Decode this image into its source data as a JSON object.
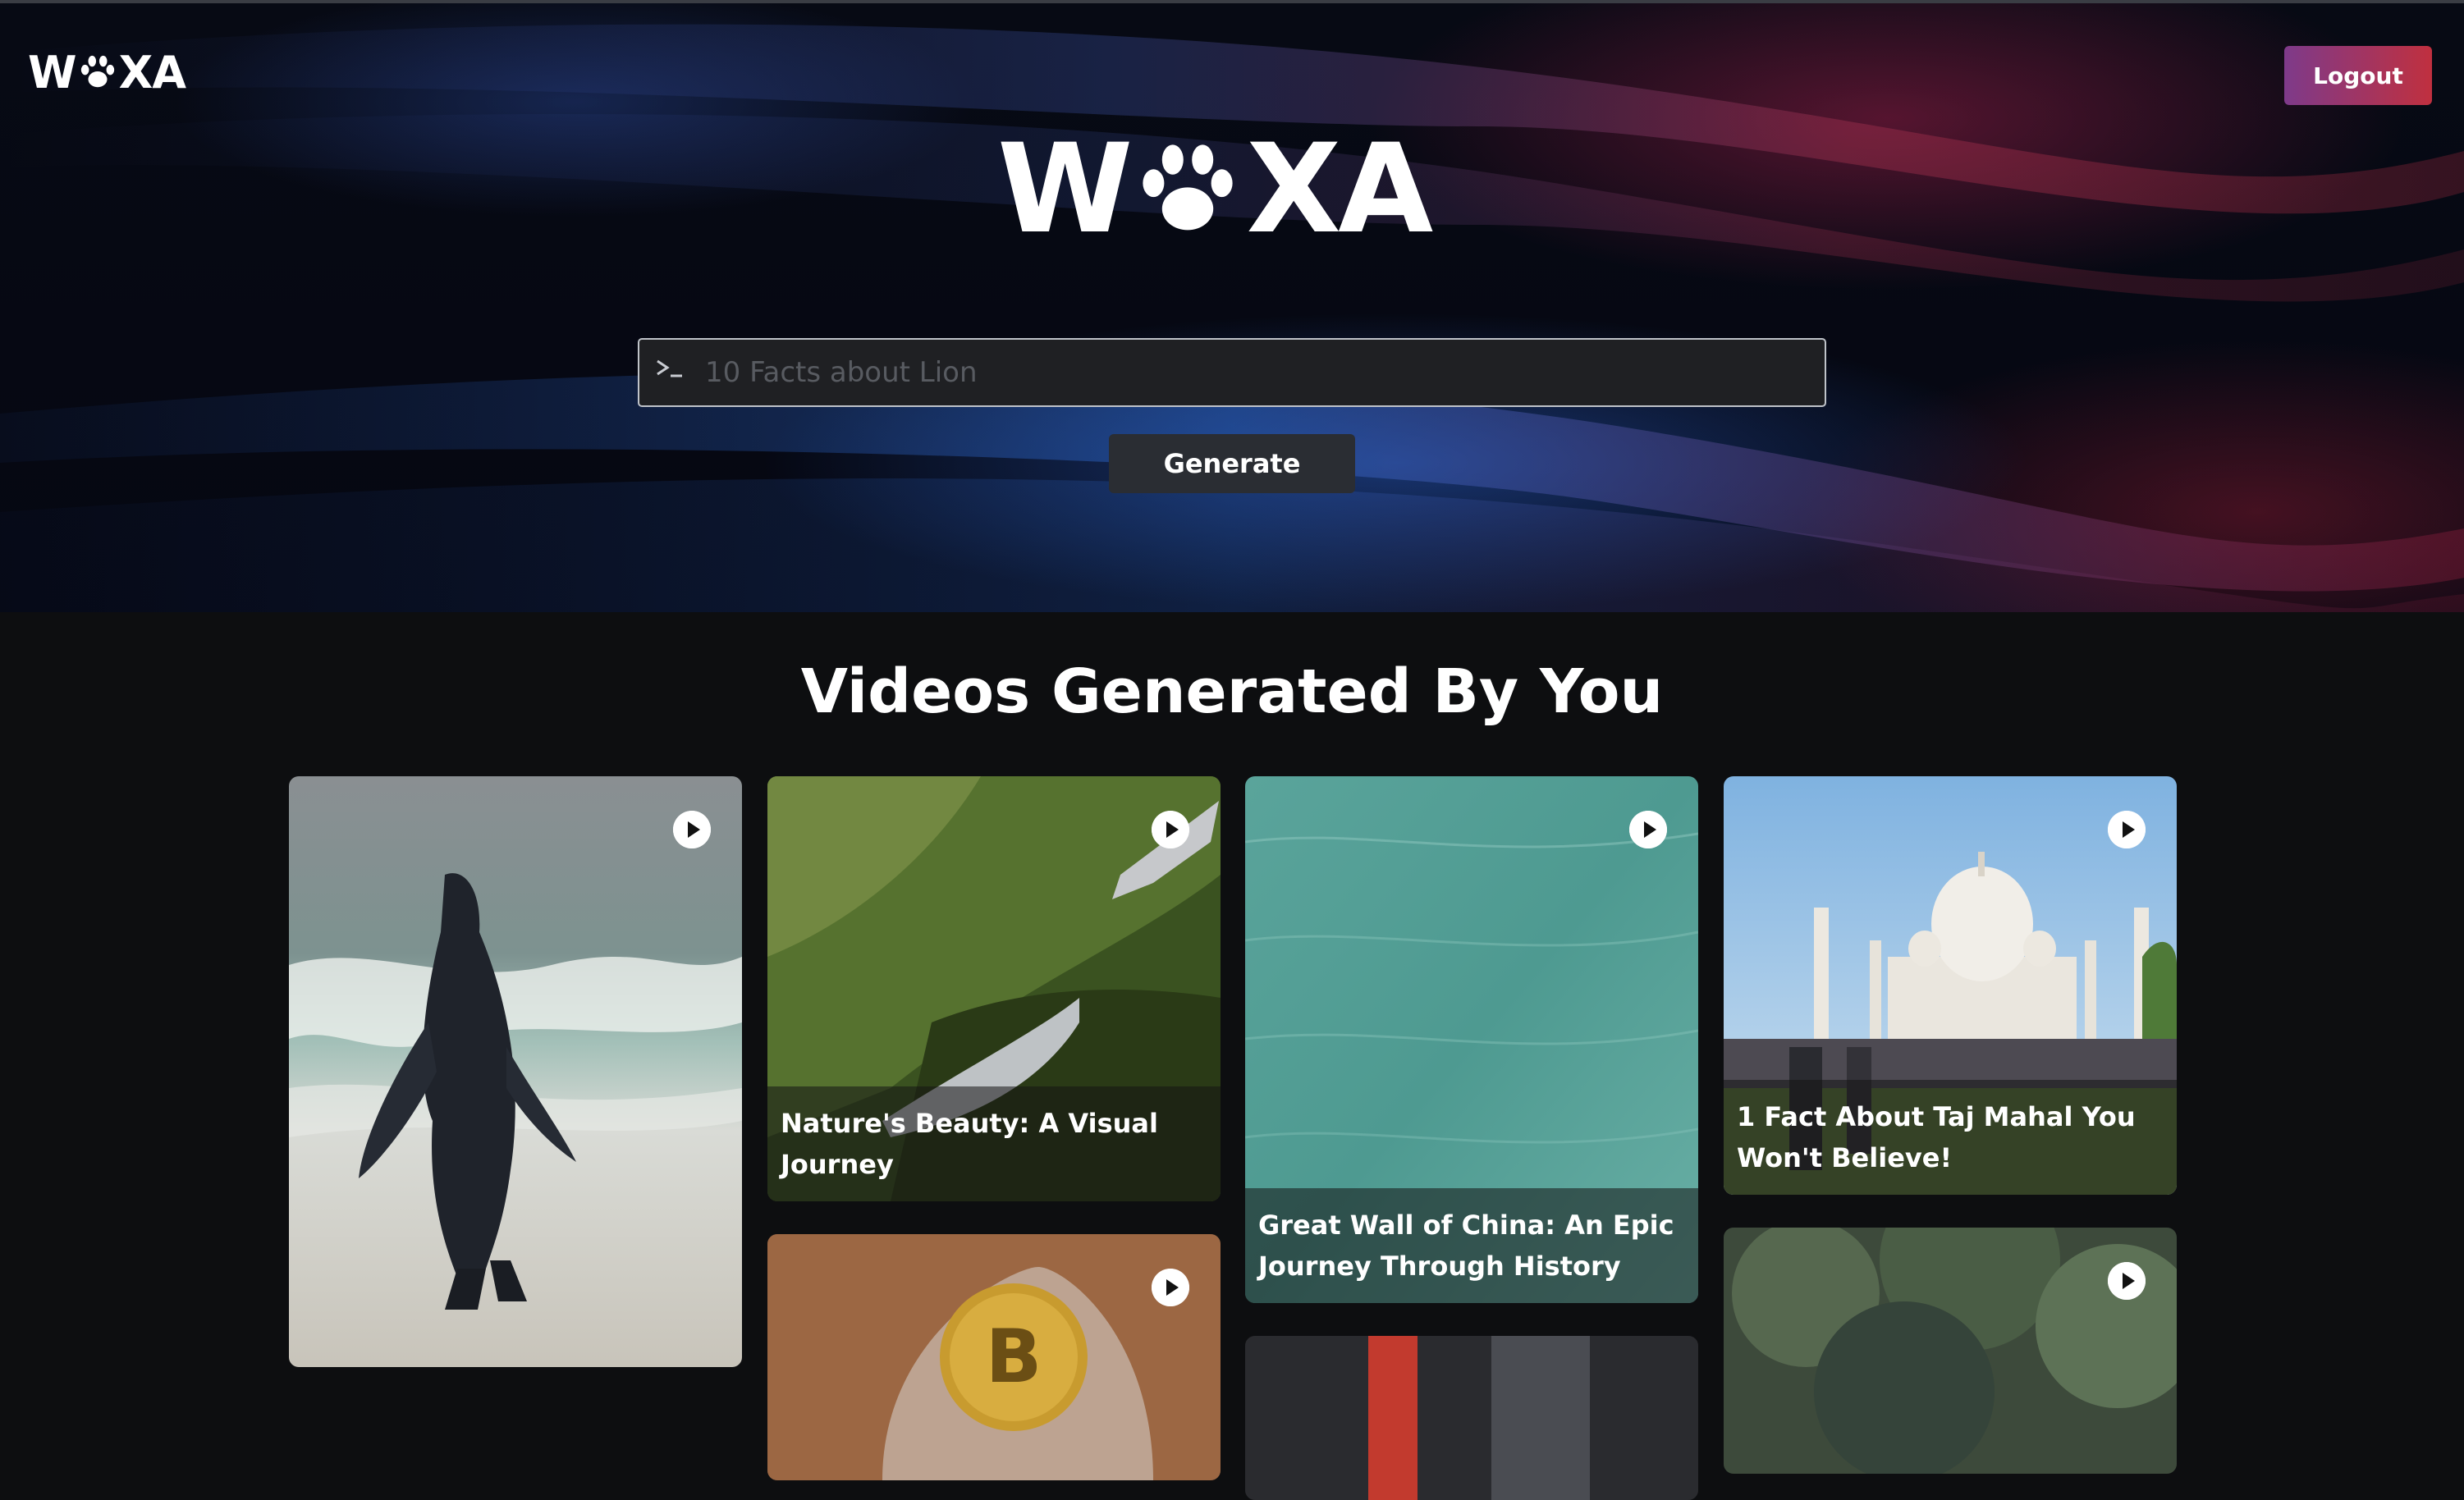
{
  "brand": {
    "name_left": "W",
    "name_right": "XA",
    "paw_icon": "paw-icon"
  },
  "header": {
    "logout_label": "Logout"
  },
  "search": {
    "placeholder": "10 Facts about Lion",
    "value": "",
    "prompt_icon": "terminal-prompt-icon"
  },
  "generate_label": "Generate",
  "section_title": "Videos Generated By You",
  "videos": [
    {
      "title": "",
      "thumbnail": "penguin on beach"
    },
    {
      "title": "Nature's Beauty: A Visual Journey",
      "thumbnail": "green mountain slope"
    },
    {
      "title": "Great Wall of China: An Epic Journey Through History",
      "thumbnail": "turquoise water surface"
    },
    {
      "title": "1 Fact About Taj Mahal You Won't Believe!",
      "thumbnail": "Taj Mahal"
    },
    {
      "title": "",
      "thumbnail": "bitcoin coin"
    },
    {
      "title": "",
      "thumbnail": "dark interior"
    },
    {
      "title": "",
      "thumbnail": "forest canopy"
    }
  ],
  "colors": {
    "logout_start": "#7e3a8a",
    "logout_end": "#c0303f",
    "page_bg": "#0d0e10"
  }
}
